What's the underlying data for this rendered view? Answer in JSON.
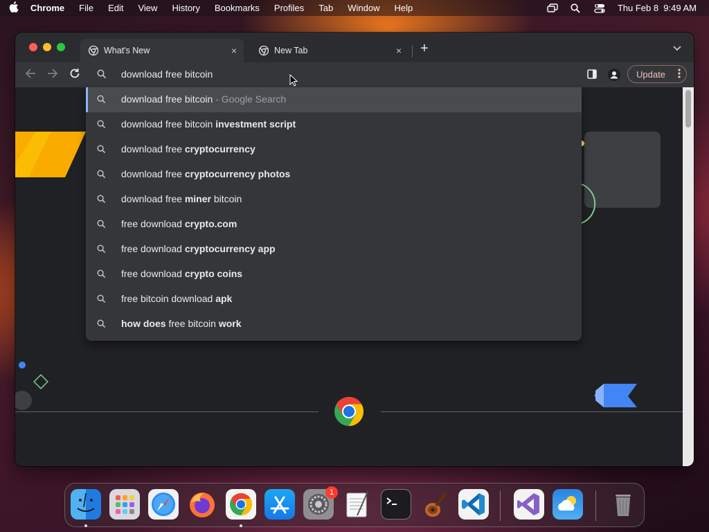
{
  "menubar": {
    "apple_icon": "apple-logo-icon",
    "app_name": "Chrome",
    "items": [
      "File",
      "Edit",
      "View",
      "History",
      "Bookmarks",
      "Profiles",
      "Tab",
      "Window",
      "Help"
    ],
    "datetime": "Thu Feb 8  9:49 AM",
    "status_icons": [
      "screen-mirror-icon",
      "spotlight-search-icon",
      "control-center-icon"
    ]
  },
  "browser": {
    "tabs": [
      {
        "title": "What's New",
        "active": true,
        "close": "×"
      },
      {
        "title": "New Tab",
        "active": false,
        "close": "×"
      }
    ],
    "new_tab_label": "+",
    "tab_search_icon": "chevron-down-icon",
    "omnibox": {
      "query": "download free bitcoin"
    },
    "update_button": "Update",
    "accent_color": "#8ab4f8"
  },
  "suggestions": [
    {
      "plain": "download free bitcoin",
      "bold": "",
      "suffix": " - Google Search",
      "selected": true
    },
    {
      "plain": "download free bitcoin ",
      "bold": "investment script",
      "suffix": "",
      "selected": false
    },
    {
      "plain": "download free ",
      "bold": "cryptocurrency",
      "suffix": "",
      "selected": false
    },
    {
      "plain": "download free ",
      "bold": "cryptocurrency photos",
      "suffix": "",
      "selected": false
    },
    {
      "plain": "download free ",
      "bold": "miner",
      "tail": " bitcoin",
      "suffix": "",
      "selected": false
    },
    {
      "plain": "free download ",
      "bold": "crypto.com",
      "suffix": "",
      "selected": false
    },
    {
      "plain": "free download ",
      "bold": "cryptocurrency app",
      "suffix": "",
      "selected": false
    },
    {
      "plain": "free download ",
      "bold": "crypto coins",
      "suffix": "",
      "selected": false
    },
    {
      "plain": "free bitcoin download ",
      "bold": "apk",
      "suffix": "",
      "selected": false
    },
    {
      "lead_bold": "how does",
      "plain": " free bitcoin ",
      "bold": "work",
      "suffix": "",
      "selected": false
    }
  ],
  "dock": {
    "apps": [
      "Finder",
      "Launchpad",
      "Safari",
      "Firefox",
      "Google Chrome",
      "App Store",
      "System Settings",
      "TextEdit",
      "Terminal",
      "GarageBand",
      "Visual Studio Code",
      "Visual Studio",
      "Weather",
      "Trash"
    ],
    "badge": "1"
  }
}
